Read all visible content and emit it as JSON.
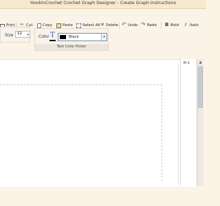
{
  "window": {
    "title": "HookinCrochet Crochet Graph Designer - Create Graph Instructions"
  },
  "toolbar": {
    "items": [
      {
        "label": "Print",
        "icon": "printer-icon"
      },
      {
        "label": "Cut",
        "icon": "scissors-icon"
      },
      {
        "label": "Copy",
        "icon": "copy-icon"
      },
      {
        "label": "Paste",
        "icon": "paste-icon"
      },
      {
        "label": "Select All",
        "icon": "select-all-icon"
      },
      {
        "label": "Delete",
        "icon": "delete-icon"
      },
      {
        "label": "Undo",
        "icon": "undo-icon"
      },
      {
        "label": "Redo",
        "icon": "redo-icon"
      },
      {
        "label": "Bold",
        "icon": "bold-icon"
      },
      {
        "label": "Italic",
        "icon": "italic-icon"
      }
    ]
  },
  "size": {
    "label": "Size",
    "value": "12"
  },
  "text_color_picker": {
    "label": "Color",
    "selected": "Black",
    "swatch_color": "#000000",
    "caption": "Text Color Picker"
  },
  "right_panel": {
    "label": "R-1"
  },
  "colors": {
    "accent_blue": "#2b5fa8",
    "background": "#fbf3e6"
  }
}
